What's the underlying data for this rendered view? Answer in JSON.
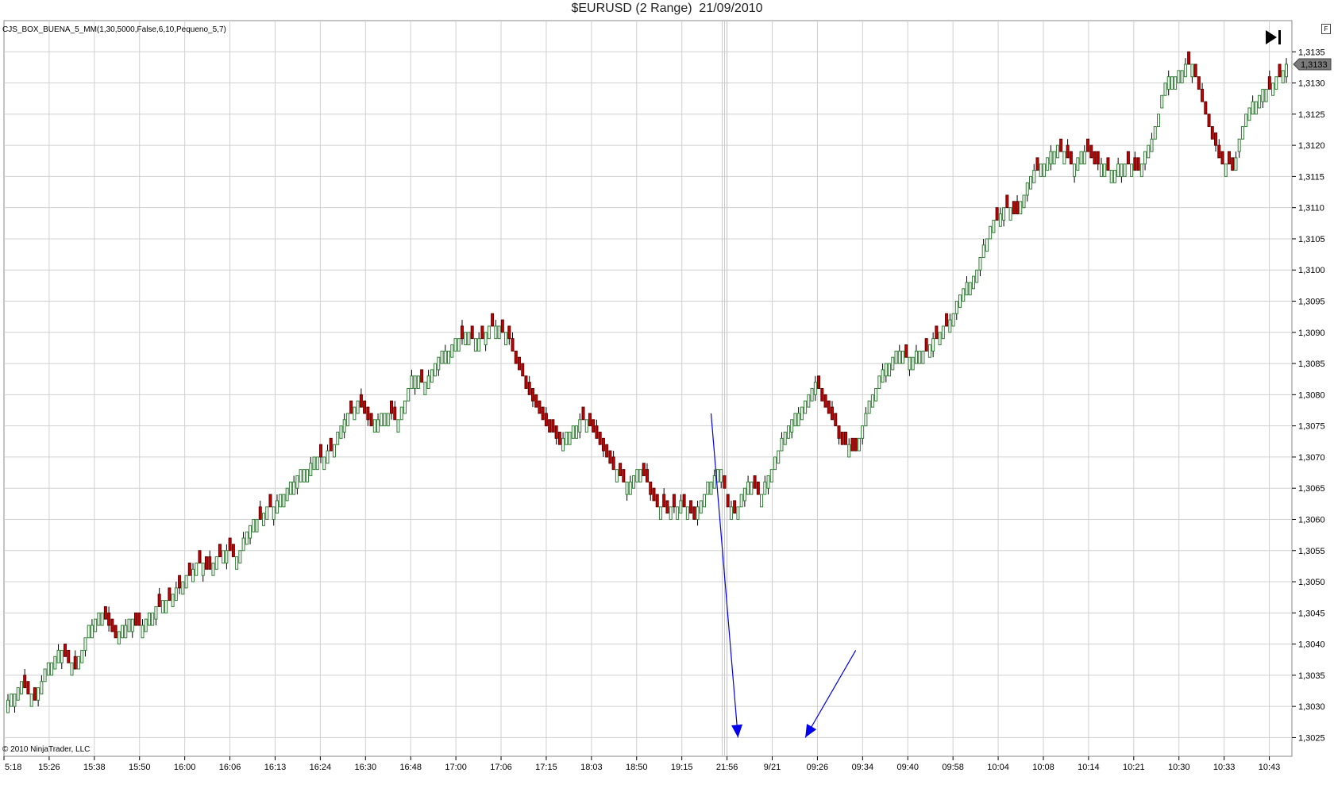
{
  "title": "$EURUSD (2 Range)  21/09/2010",
  "indicator_label": "CJS_BOX_BUENA_5_MM(1,30,5000,False,6,10,Pequeno_5,7)",
  "copyright": "© 2010 NinjaTrader, LLC",
  "controls": {
    "end_icon": "skip-to-end-icon",
    "f_button_label": "F"
  },
  "colors": {
    "up_candle": "#ffffff",
    "up_border": "#2e7d32",
    "down_candle": "#cc0000",
    "grid": "#d0d0d0",
    "arrow": "#0000ee",
    "price_marker": "#7a7a7a"
  },
  "chart_data": {
    "type": "candlestick",
    "title": "$EURUSD (2 Range)  21/09/2010",
    "symbol": "$EURUSD",
    "bar_type": "2 Range",
    "date": "21/09/2010",
    "y_axis": {
      "ylim": [
        1.3022,
        1.314
      ],
      "tick_labels": [
        "1,3025",
        "1,3030",
        "1,3035",
        "1,3040",
        "1,3045",
        "1,3050",
        "1,3055",
        "1,3060",
        "1,3065",
        "1,3070",
        "1,3075",
        "1,3080",
        "1,3085",
        "1,3090",
        "1,3095",
        "1,3100",
        "1,3105",
        "1,3110",
        "1,3115",
        "1,3120",
        "1,3125",
        "1,3130",
        "1,3135"
      ],
      "tick_values": [
        1.3025,
        1.303,
        1.3035,
        1.304,
        1.3045,
        1.305,
        1.3055,
        1.306,
        1.3065,
        1.307,
        1.3075,
        1.308,
        1.3085,
        1.309,
        1.3095,
        1.31,
        1.3105,
        1.311,
        1.3115,
        1.312,
        1.3125,
        1.313,
        1.3135
      ],
      "position": "right"
    },
    "x_axis": {
      "tick_labels": [
        "5:18",
        "15:26",
        "15:38",
        "15:50",
        "16:00",
        "16:06",
        "16:13",
        "16:24",
        "16:30",
        "16:48",
        "17:00",
        "17:06",
        "17:15",
        "18:03",
        "18:50",
        "19:15",
        "21:56",
        "9/21",
        "09:26",
        "09:34",
        "09:40",
        "09:58",
        "10:04",
        "10:08",
        "10:14",
        "10:21",
        "10:30",
        "10:33",
        "10:43"
      ]
    },
    "last_price": 1.3133,
    "last_price_label": "1,3133",
    "session_break_index": 213,
    "grid": true,
    "close_path": [
      [
        0,
        1.3031
      ],
      [
        4,
        1.3034
      ],
      [
        8,
        1.3031
      ],
      [
        12,
        1.3037
      ],
      [
        16,
        1.3039
      ],
      [
        20,
        1.3036
      ],
      [
        24,
        1.3043
      ],
      [
        28,
        1.3045
      ],
      [
        32,
        1.3041
      ],
      [
        36,
        1.3044
      ],
      [
        40,
        1.3043
      ],
      [
        44,
        1.3046
      ],
      [
        48,
        1.3047
      ],
      [
        52,
        1.305
      ],
      [
        56,
        1.3053
      ],
      [
        60,
        1.3052
      ],
      [
        64,
        1.3055
      ],
      [
        68,
        1.3054
      ],
      [
        72,
        1.3059
      ],
      [
        76,
        1.3061
      ],
      [
        80,
        1.3063
      ],
      [
        84,
        1.3066
      ],
      [
        88,
        1.3068
      ],
      [
        92,
        1.307
      ],
      [
        96,
        1.3071
      ],
      [
        100,
        1.3076
      ],
      [
        104,
        1.3079
      ],
      [
        108,
        1.3075
      ],
      [
        112,
        1.3077
      ],
      [
        116,
        1.3076
      ],
      [
        120,
        1.3083
      ],
      [
        124,
        1.3082
      ],
      [
        128,
        1.3086
      ],
      [
        132,
        1.3088
      ],
      [
        136,
        1.309
      ],
      [
        140,
        1.3089
      ],
      [
        144,
        1.3091
      ],
      [
        148,
        1.309
      ],
      [
        152,
        1.3084
      ],
      [
        156,
        1.3079
      ],
      [
        160,
        1.3075
      ],
      [
        164,
        1.3072
      ],
      [
        168,
        1.3075
      ],
      [
        172,
        1.3076
      ],
      [
        176,
        1.3072
      ],
      [
        180,
        1.3068
      ],
      [
        184,
        1.3066
      ],
      [
        188,
        1.3068
      ],
      [
        192,
        1.3063
      ],
      [
        196,
        1.3061
      ],
      [
        200,
        1.3063
      ],
      [
        204,
        1.306
      ],
      [
        208,
        1.3066
      ],
      [
        212,
        1.3068
      ],
      [
        214,
        1.3062
      ],
      [
        216,
        1.3061
      ],
      [
        220,
        1.3066
      ],
      [
        224,
        1.3064
      ],
      [
        228,
        1.307
      ],
      [
        232,
        1.3075
      ],
      [
        236,
        1.3078
      ],
      [
        240,
        1.3082
      ],
      [
        244,
        1.3077
      ],
      [
        248,
        1.3072
      ],
      [
        252,
        1.3071
      ],
      [
        256,
        1.3079
      ],
      [
        260,
        1.3084
      ],
      [
        264,
        1.3087
      ],
      [
        268,
        1.3086
      ],
      [
        272,
        1.3087
      ],
      [
        276,
        1.3089
      ],
      [
        280,
        1.3092
      ],
      [
        284,
        1.3097
      ],
      [
        288,
        1.31
      ],
      [
        292,
        1.3107
      ],
      [
        296,
        1.311
      ],
      [
        300,
        1.3109
      ],
      [
        304,
        1.3115
      ],
      [
        308,
        1.3117
      ],
      [
        312,
        1.312
      ],
      [
        316,
        1.3117
      ],
      [
        320,
        1.3119
      ],
      [
        324,
        1.3117
      ],
      [
        328,
        1.3116
      ],
      [
        332,
        1.3117
      ],
      [
        336,
        1.3116
      ],
      [
        340,
        1.3121
      ],
      [
        344,
        1.313
      ],
      [
        348,
        1.3132
      ],
      [
        352,
        1.3133
      ],
      [
        356,
        1.3125
      ],
      [
        360,
        1.3118
      ],
      [
        364,
        1.3116
      ],
      [
        368,
        1.3125
      ],
      [
        372,
        1.3128
      ],
      [
        376,
        1.313
      ],
      [
        380,
        1.3133
      ]
    ],
    "annotations": [
      {
        "type": "arrow",
        "from_time_index": 209,
        "from_price": 1.3077,
        "to_time_index": 217,
        "to_price": 1.3025
      },
      {
        "type": "arrow",
        "from_time_index": 252,
        "from_price": 1.3039,
        "to_time_index": 237,
        "to_price": 1.3025
      }
    ]
  }
}
